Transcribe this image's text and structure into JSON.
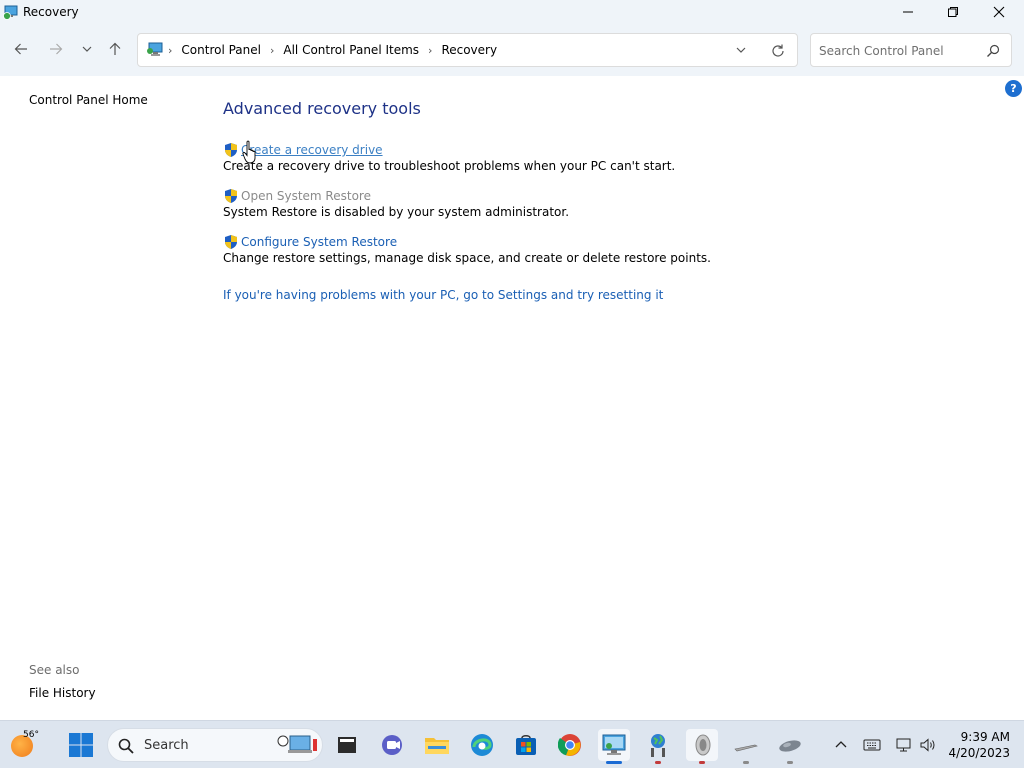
{
  "window": {
    "title": "Recovery"
  },
  "address": {
    "crumbs": [
      "Control Panel",
      "All Control Panel Items",
      "Recovery"
    ]
  },
  "search": {
    "placeholder": "Search Control Panel"
  },
  "left": {
    "home": "Control Panel Home",
    "see_also": "See also",
    "file_history": "File History"
  },
  "main": {
    "title": "Advanced recovery tools",
    "tasks": [
      {
        "link": "Create a recovery drive",
        "desc": "Create a recovery drive to troubleshoot problems when your PC can't start."
      },
      {
        "link": "Open System Restore",
        "desc": "System Restore is disabled by your system administrator."
      },
      {
        "link": "Configure System Restore",
        "desc": "Change restore settings, manage disk space, and create or delete restore points."
      }
    ],
    "reset_link": "If you're having problems with your PC, go to Settings and try resetting it",
    "help": "?"
  },
  "taskbar": {
    "temperature": "56°",
    "search_label": "Search",
    "time": "9:39 AM",
    "date": "4/20/2023",
    "icons": [
      "windows-start-icon",
      "file-explorer-icon",
      "meet-icon",
      "folder-icon",
      "edge-icon",
      "store-icon",
      "chrome-icon",
      "control-panel-icon",
      "network-globe-icon",
      "speaker-icon",
      "pen-icon",
      "mouse-icon"
    ]
  },
  "colors": {
    "accent": "#1a6ad3",
    "title_blue": "#1e3287",
    "link": "#1a5fb4"
  }
}
